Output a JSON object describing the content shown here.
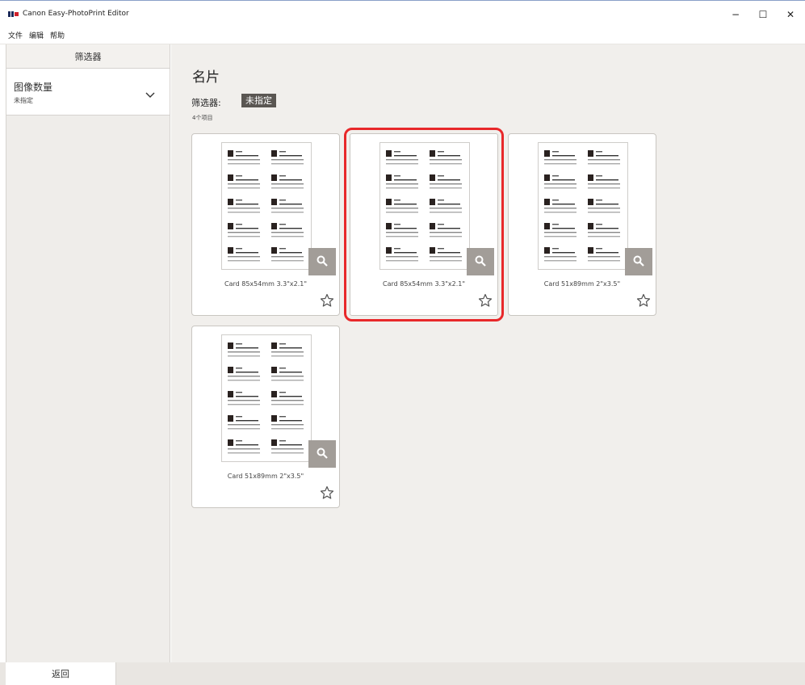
{
  "window": {
    "title": "Canon Easy-PhotoPrint Editor",
    "minimize": "−",
    "maximize": "☐",
    "close": "✕"
  },
  "menu": {
    "items": [
      "文件",
      "编辑",
      "帮助"
    ]
  },
  "sidebar": {
    "header": "筛选器",
    "filter": {
      "title": "图像数量",
      "value": "未指定"
    }
  },
  "main": {
    "title": "名片",
    "filter_label": "筛选器:",
    "filter_chip": "未指定",
    "item_count": "4个项目",
    "cards": [
      {
        "label": "Card 85x54mm 3.3\"x2.1\"",
        "selected": false
      },
      {
        "label": "Card 85x54mm 3.3\"x2.1\"",
        "selected": true
      },
      {
        "label": "Card 51x89mm 2\"x3.5\"",
        "selected": false
      },
      {
        "label": "Card 51x89mm 2\"x3.5\"",
        "selected": false
      }
    ]
  },
  "footer": {
    "back_label": "返回"
  },
  "colors": {
    "selection": "#e8282a",
    "chip_bg": "#5a5652",
    "zoom_bg": "#a29d98"
  }
}
